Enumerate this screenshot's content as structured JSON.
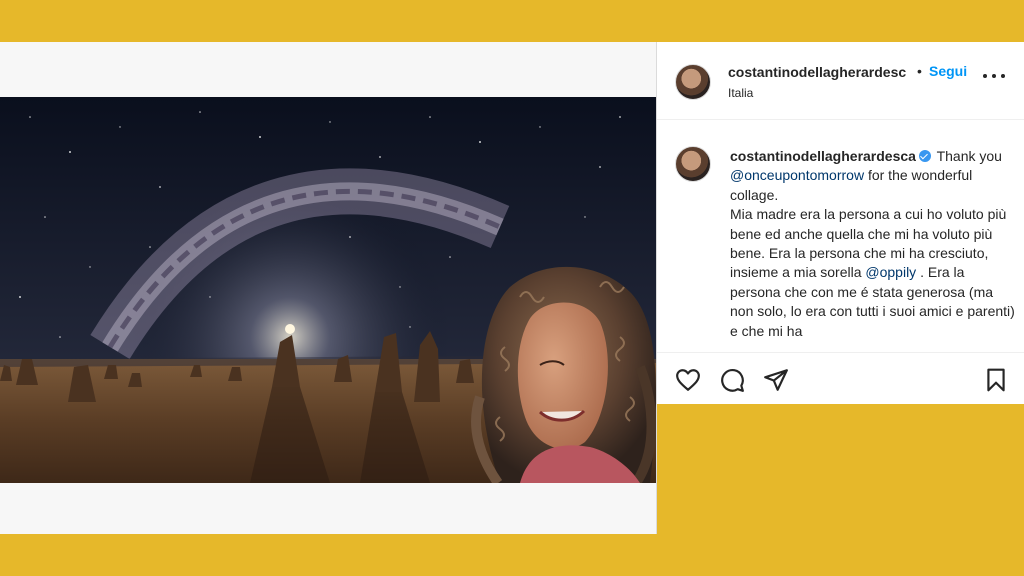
{
  "post": {
    "username": "costantinodellagherardesc",
    "separator": "•",
    "follow_label": "Segui",
    "location": "Italia"
  },
  "caption": {
    "username": "costantinodellagherardesca",
    "part1": " Thank you ",
    "mention1": "@onceupontomorrow",
    "part2": " for the wonderful collage.",
    "part3": "Mia madre era la persona a cui ho voluto più bene ed anche quella che mi ha voluto più bene. Era la persona che mi ha cresciuto, insieme a mia sorella ",
    "mention2": "@oppily",
    "part4": " . Era la persona che con me é stata generosa (ma non solo, lo era con tutti i suoi amici e parenti) e che mi ha"
  },
  "icons": {
    "like": "heart-icon",
    "comment": "comment-icon",
    "share": "send-icon",
    "save": "bookmark-icon",
    "more": "more-horizontal-icon",
    "verified": "verified-badge-icon"
  },
  "colors": {
    "page_background": "#e6b82a",
    "link_blue": "#0095f6",
    "mention_blue": "#00376b",
    "verified_blue": "#3897f0"
  }
}
